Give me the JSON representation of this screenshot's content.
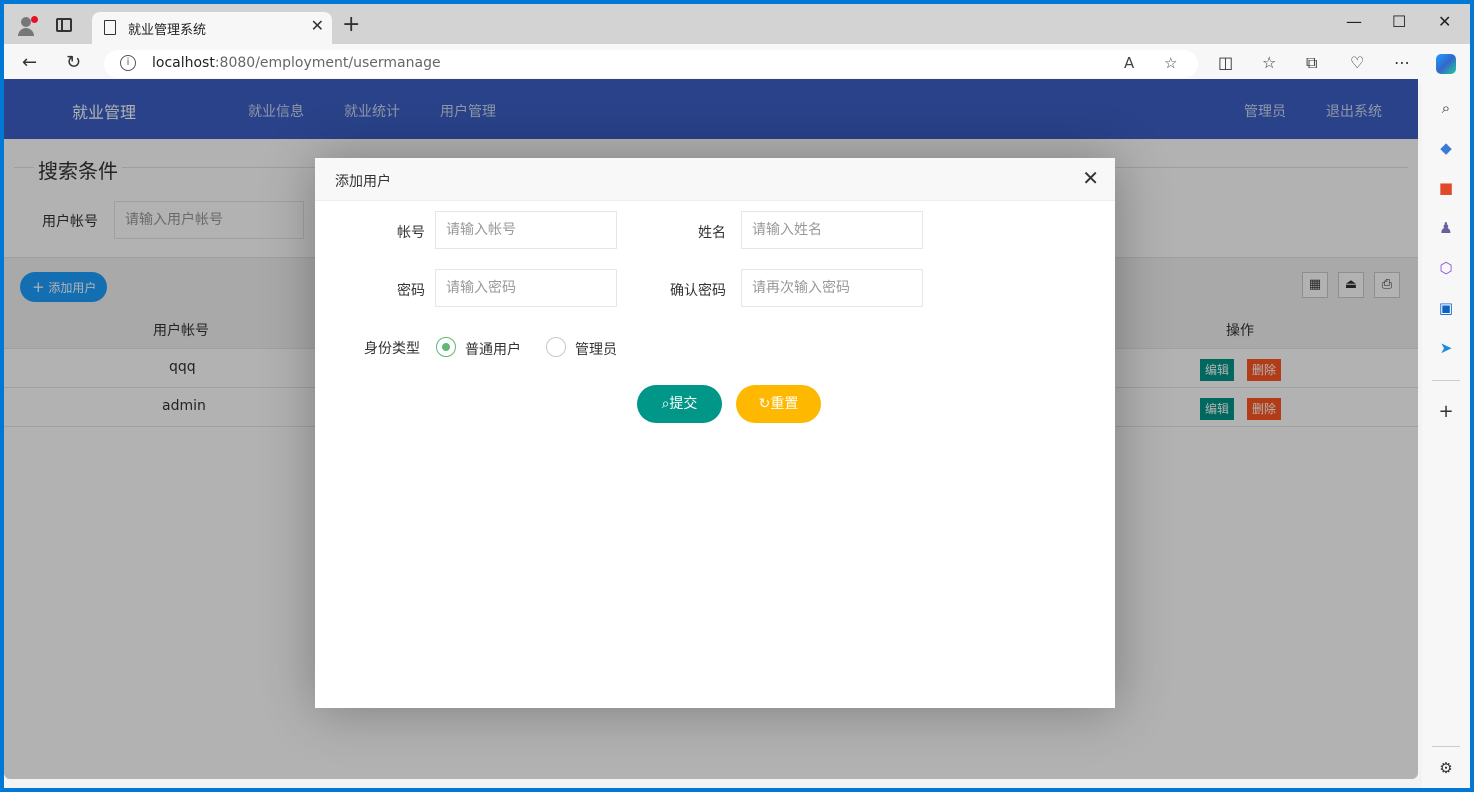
{
  "browser": {
    "tab_title": "就业管理系统",
    "tab_close": "✕",
    "new_tab": "+",
    "url_host": "localhost",
    "url_rest": ":8080/employment/usermanage",
    "min": "—",
    "max": "☐",
    "close": "✕"
  },
  "app": {
    "brand": "就业管理",
    "nav": [
      "就业信息",
      "就业统计",
      "用户管理"
    ],
    "user": "管理员",
    "logout": "退出系统"
  },
  "search": {
    "title": "搜索条件",
    "label": "用户帐号",
    "placeholder": "请输入用户帐号"
  },
  "toolbar": {
    "add_label": "添加用户"
  },
  "table": {
    "headers": [
      "用户帐号",
      "操作"
    ],
    "rows": [
      {
        "account": "qqq",
        "edit": "编辑",
        "delete": "删除"
      },
      {
        "account": "admin",
        "edit": "编辑",
        "delete": "删除"
      }
    ]
  },
  "modal": {
    "title": "添加用户",
    "fields": {
      "account_label": "帐号",
      "account_placeholder": "请输入帐号",
      "name_label": "姓名",
      "name_placeholder": "请输入姓名",
      "password_label": "密码",
      "password_placeholder": "请输入密码",
      "confirm_label": "确认密码",
      "confirm_placeholder": "请再次输入密码",
      "role_label": "身份类型",
      "role_options": [
        "普通用户",
        "管理员"
      ],
      "role_selected": "普通用户"
    },
    "submit_label": "提交",
    "reset_label": "重置"
  },
  "colors": {
    "nav_bg": "#3b5fc4",
    "submit": "#009688",
    "reset": "#ffb800",
    "add": "#1e9fff",
    "delete": "#ff5722"
  }
}
